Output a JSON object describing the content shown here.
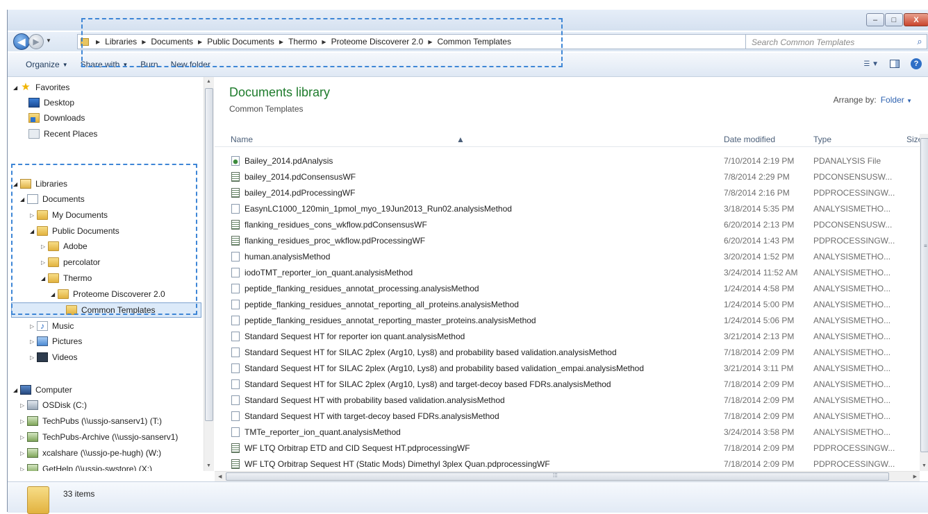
{
  "window": {
    "controls": {
      "minimize": "–",
      "maximize": "□",
      "close": "X"
    }
  },
  "address": {
    "breadcrumbs": [
      "Libraries",
      "Documents",
      "Public Documents",
      "Thermo",
      "Proteome Discoverer 2.0",
      "Common Templates"
    ],
    "search_placeholder": "Search Common Templates"
  },
  "toolbar": {
    "organize": "Organize",
    "share_with": "Share with",
    "burn": "Burn",
    "new_folder": "New folder"
  },
  "nav": {
    "favorites": {
      "label": "Favorites",
      "items": [
        "Desktop",
        "Downloads",
        "Recent Places"
      ]
    },
    "libraries": {
      "label": "Libraries",
      "documents": "Documents",
      "my_documents": "My Documents",
      "public_documents": "Public Documents",
      "adobe": "Adobe",
      "percolator": "percolator",
      "thermo": "Thermo",
      "proteome_discoverer": "Proteome Discoverer 2.0",
      "common_templates": "Common Templates",
      "music": "Music",
      "pictures": "Pictures",
      "videos": "Videos"
    },
    "computer": {
      "label": "Computer",
      "drives": [
        "OSDisk (C:)",
        "TechPubs (\\\\ussjo-sanserv1) (T:)",
        "TechPubs-Archive (\\\\ussjo-sanserv1)",
        "xcalshare (\\\\ussjo-pe-hugh) (W:)",
        "GetHelp (\\\\ussjo-swstore) (X:)"
      ]
    }
  },
  "library_header": {
    "title": "Documents library",
    "subtitle": "Common Templates",
    "arrange_label": "Arrange by:",
    "arrange_value": "Folder"
  },
  "columns": {
    "name": "Name",
    "date": "Date modified",
    "type": "Type",
    "size": "Size"
  },
  "files": [
    {
      "name": "Bailey_2014.pdAnalysis",
      "date": "7/10/2014 2:19 PM",
      "type": "PDANALYSIS File",
      "icon": "analysis-icon"
    },
    {
      "name": "bailey_2014.pdConsensusWF",
      "date": "7/8/2014 2:29 PM",
      "type": "PDCONSENSUSW...",
      "icon": "workflow-icon"
    },
    {
      "name": "bailey_2014.pdProcessingWF",
      "date": "7/8/2014 2:16 PM",
      "type": "PDPROCESSINGW...",
      "icon": "workflow-icon"
    },
    {
      "name": "EasynLC1000_120min_1pmol_myo_19Jun2013_Run02.analysisMethod",
      "date": "3/18/2014 5:35 PM",
      "type": "ANALYSISMETHO...",
      "icon": "file-icon"
    },
    {
      "name": "flanking_residues_cons_wkflow.pdConsensusWF",
      "date": "6/20/2014 2:13 PM",
      "type": "PDCONSENSUSW...",
      "icon": "workflow-icon"
    },
    {
      "name": "flanking_residues_proc_wkflow.pdProcessingWF",
      "date": "6/20/2014 1:43 PM",
      "type": "PDPROCESSINGW...",
      "icon": "workflow-icon"
    },
    {
      "name": "human.analysisMethod",
      "date": "3/20/2014 1:52 PM",
      "type": "ANALYSISMETHO...",
      "icon": "file-icon"
    },
    {
      "name": "iodoTMT_reporter_ion_quant.analysisMethod",
      "date": "3/24/2014 11:52 AM",
      "type": "ANALYSISMETHO...",
      "icon": "file-icon"
    },
    {
      "name": "peptide_flanking_residues_annotat_processing.analysisMethod",
      "date": "1/24/2014 4:58 PM",
      "type": "ANALYSISMETHO...",
      "icon": "file-icon"
    },
    {
      "name": "peptide_flanking_residues_annotat_reporting_all_proteins.analysisMethod",
      "date": "1/24/2014 5:00 PM",
      "type": "ANALYSISMETHO...",
      "icon": "file-icon"
    },
    {
      "name": "peptide_flanking_residues_annotat_reporting_master_proteins.analysisMethod",
      "date": "1/24/2014 5:06 PM",
      "type": "ANALYSISMETHO...",
      "icon": "file-icon"
    },
    {
      "name": "Standard Sequest HT for reporter ion quant.analysisMethod",
      "date": "3/21/2014 2:13 PM",
      "type": "ANALYSISMETHO...",
      "icon": "file-icon"
    },
    {
      "name": "Standard Sequest HT for SILAC 2plex (Arg10, Lys8) and probability based validation.analysisMethod",
      "date": "7/18/2014 2:09 PM",
      "type": "ANALYSISMETHO...",
      "icon": "file-icon"
    },
    {
      "name": "Standard Sequest HT for SILAC 2plex (Arg10, Lys8) and probability based validation_empai.analysisMethod",
      "date": "3/21/2014 3:11 PM",
      "type": "ANALYSISMETHO...",
      "icon": "file-icon"
    },
    {
      "name": "Standard Sequest HT for SILAC 2plex (Arg10, Lys8) and target-decoy based FDRs.analysisMethod",
      "date": "7/18/2014 2:09 PM",
      "type": "ANALYSISMETHO...",
      "icon": "file-icon"
    },
    {
      "name": "Standard Sequest HT with probability based validation.analysisMethod",
      "date": "7/18/2014 2:09 PM",
      "type": "ANALYSISMETHO...",
      "icon": "file-icon"
    },
    {
      "name": "Standard Sequest HT with target-decoy based FDRs.analysisMethod",
      "date": "7/18/2014 2:09 PM",
      "type": "ANALYSISMETHO...",
      "icon": "file-icon"
    },
    {
      "name": "TMTe_reporter_ion_quant.analysisMethod",
      "date": "3/24/2014 3:58 PM",
      "type": "ANALYSISMETHO...",
      "icon": "file-icon"
    },
    {
      "name": "WF LTQ Orbitrap ETD and CID Sequest HT.pdprocessingWF",
      "date": "7/18/2014 2:09 PM",
      "type": "PDPROCESSINGW...",
      "icon": "workflow-icon"
    },
    {
      "name": "WF LTQ Orbitrap Sequest HT (Static Mods) Dimethyl 3plex Quan.pdprocessingWF",
      "date": "7/18/2014 2:09 PM",
      "type": "PDPROCESSINGW...",
      "icon": "workflow-icon"
    }
  ],
  "status": {
    "item_count": "33 items"
  },
  "colors": {
    "library_title": "#1e7b2c",
    "highlight_dash": "#3e86d6",
    "link_blue": "#2e62b0"
  }
}
